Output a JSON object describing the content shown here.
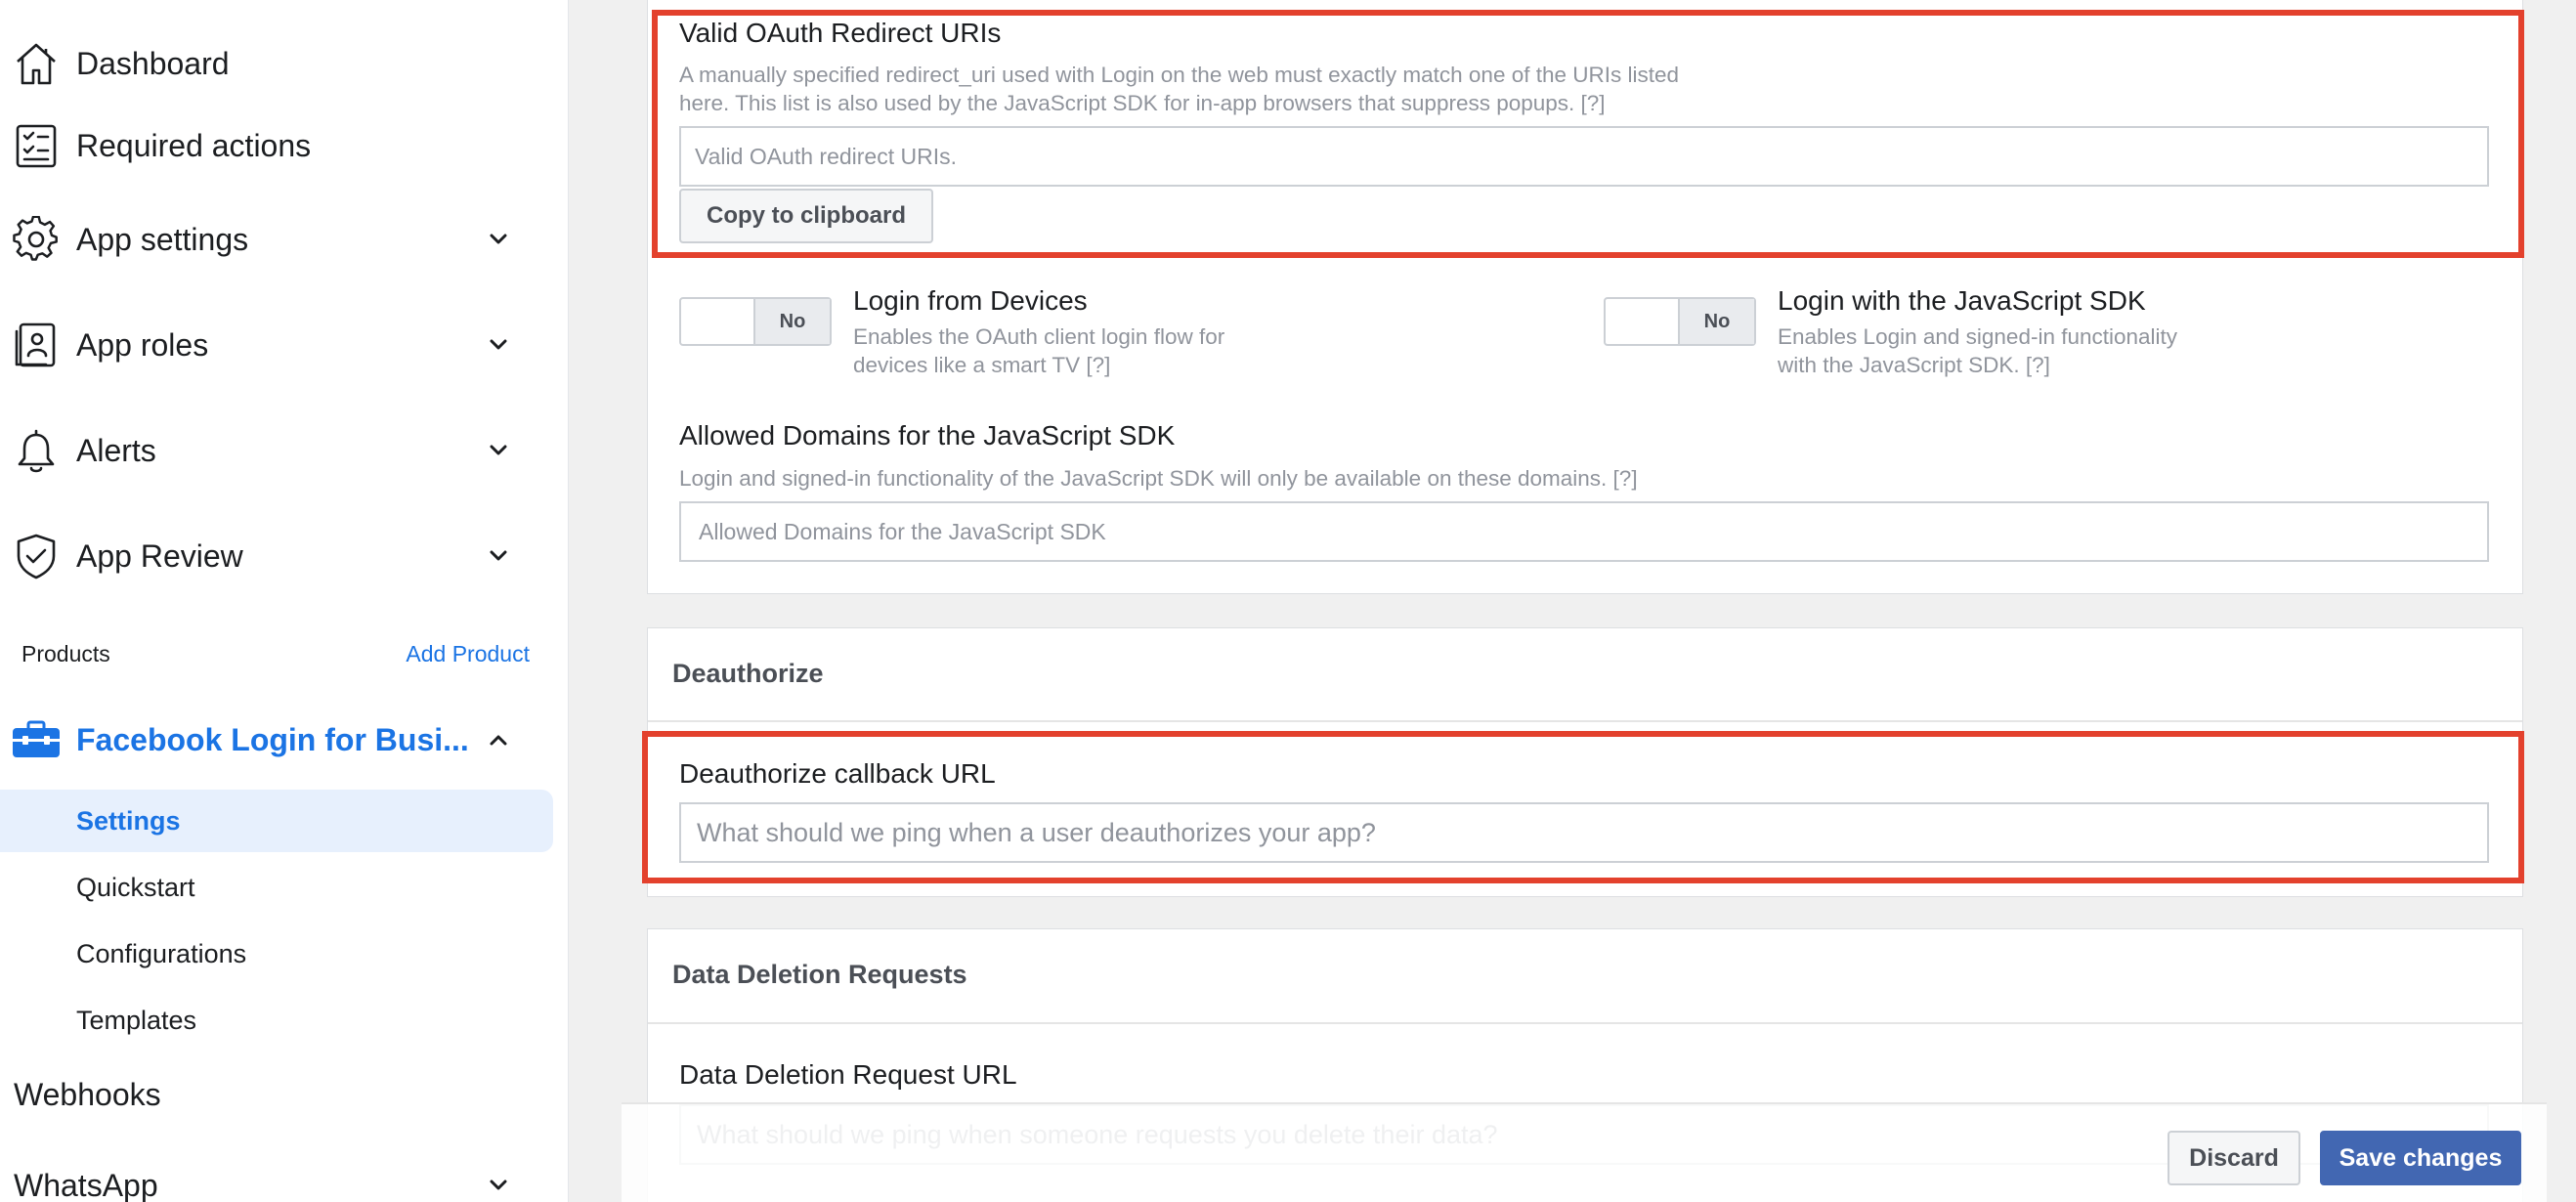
{
  "sidebar": {
    "dashboard": "Dashboard",
    "required_actions": "Required actions",
    "app_settings": "App settings",
    "app_roles": "App roles",
    "alerts": "Alerts",
    "app_review": "App Review",
    "products_label": "Products",
    "add_product": "Add Product",
    "product_name": "Facebook Login for Busi...",
    "sub_items": [
      "Settings",
      "Quickstart",
      "Configurations",
      "Templates"
    ],
    "webhooks": "Webhooks",
    "whatsapp": "WhatsApp"
  },
  "oauth": {
    "label": "Valid OAuth Redirect URIs",
    "help_line1": "A manually specified redirect_uri used with Login on the web must exactly match one of the URIs listed",
    "help_line2": "here. This list is also used by the JavaScript SDK for in-app browsers that suppress popups.  [?]",
    "placeholder": "Valid OAuth redirect URIs.",
    "copy_button": "Copy to clipboard"
  },
  "login_devices": {
    "toggle": "No",
    "title": "Login from Devices",
    "help_line1": "Enables the OAuth client login flow for",
    "help_line2": "devices like a smart TV [?]"
  },
  "login_js": {
    "toggle": "No",
    "title": "Login with the JavaScript SDK",
    "help_line1": "Enables Login and signed-in functionality",
    "help_line2": "with the JavaScript SDK.  [?]"
  },
  "domains": {
    "label": "Allowed Domains for the JavaScript SDK",
    "help": "Login and signed-in functionality of the JavaScript SDK will only be available on these domains.  [?]",
    "placeholder": "Allowed Domains for the JavaScript SDK"
  },
  "deauthorize": {
    "section_title": "Deauthorize",
    "label": "Deauthorize callback URL",
    "placeholder": "What should we ping when a user deauthorizes your app?"
  },
  "data_deletion": {
    "section_title": "Data Deletion Requests",
    "label": "Data Deletion Request URL",
    "placeholder": "What should we ping when someone requests you delete their data?"
  },
  "footer": {
    "discard": "Discard",
    "save": "Save changes"
  },
  "colors": {
    "accent": "#1b74e4",
    "save_button": "#4267b2",
    "highlight": "#e3412d"
  }
}
